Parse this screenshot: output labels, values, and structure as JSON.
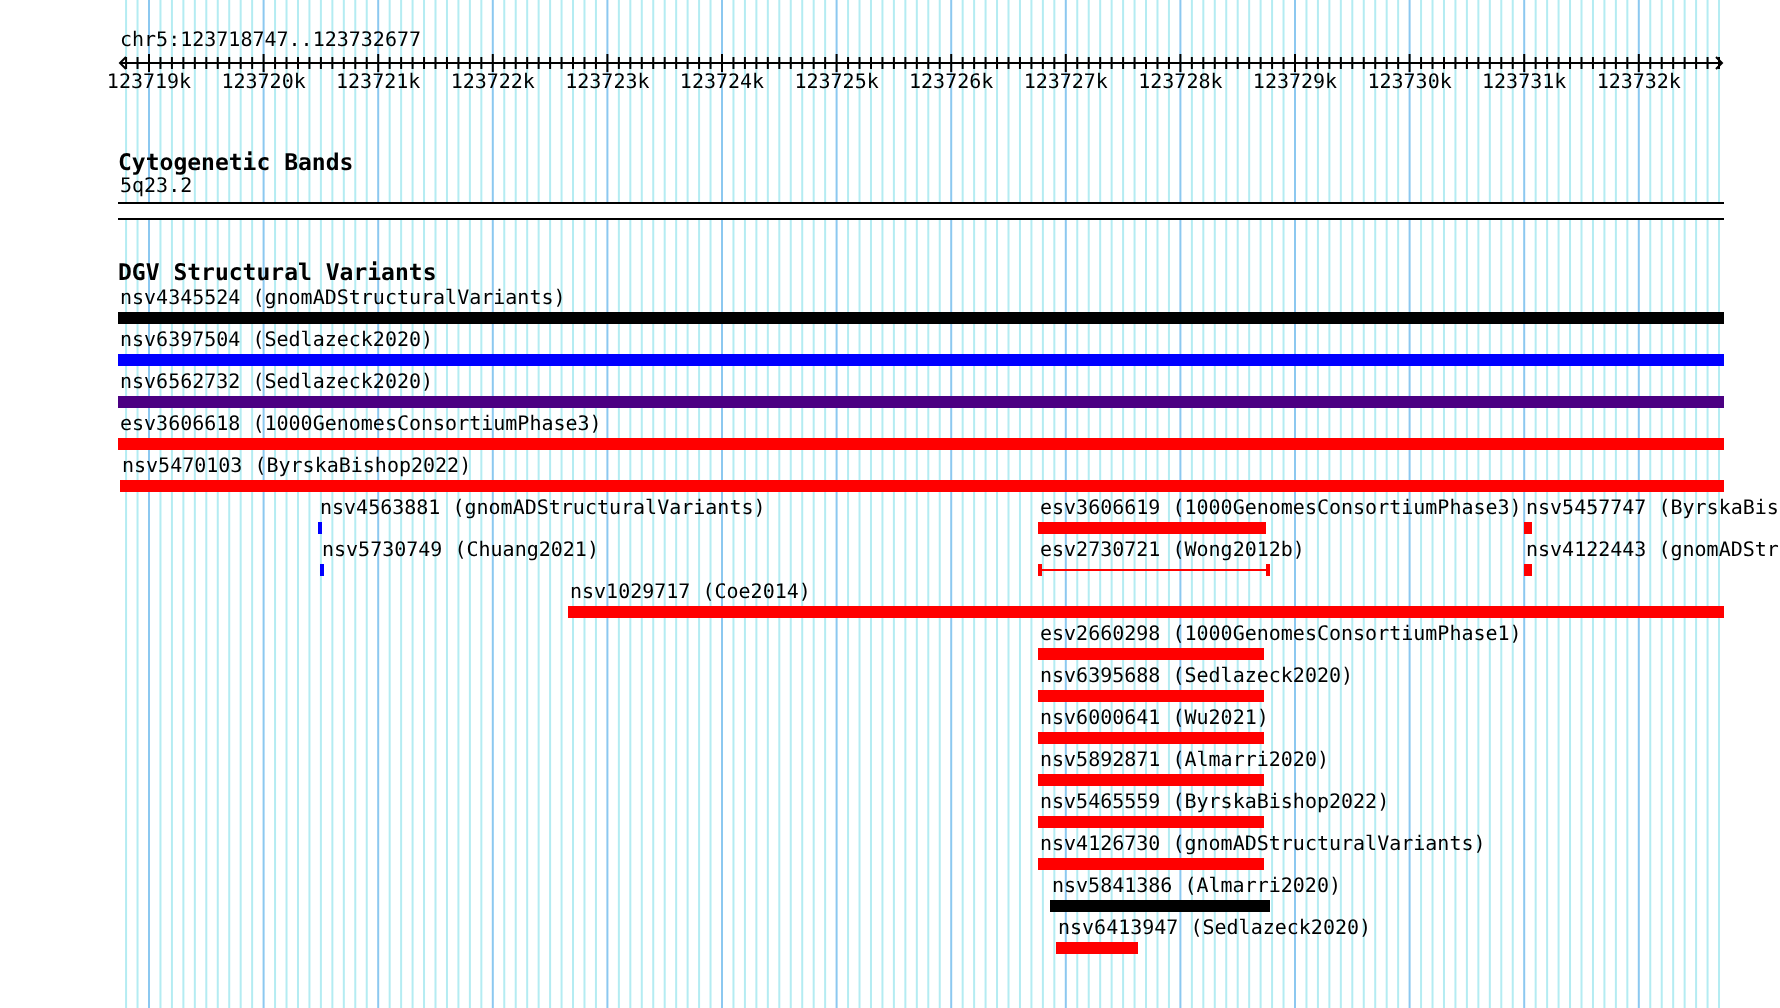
{
  "ruler": {
    "locus": "chr5:123718747..123732677",
    "tick_labels": [
      "123719k",
      "123720k",
      "123721k",
      "123722k",
      "123723k",
      "123724k",
      "123725k",
      "123726k",
      "123727k",
      "123728k",
      "123729k",
      "123730k",
      "123731k",
      "123732k"
    ]
  },
  "cytogenetic_bands": {
    "title": "Cytogenetic Bands",
    "band_label": "5q23.2"
  },
  "dgv_track": {
    "title": "DGV Structural Variants",
    "features": [
      {
        "label": "nsv4345524 (gnomADStructuralVariants)",
        "color": "#000000",
        "kind": "bar"
      },
      {
        "label": "nsv6397504 (Sedlazeck2020)",
        "color": "#0000ff",
        "kind": "bar"
      },
      {
        "label": "nsv6562732 (Sedlazeck2020)",
        "color": "#4b0082",
        "kind": "bar"
      },
      {
        "label": "esv3606618 (1000GenomesConsortiumPhase3)",
        "color": "#ff0000",
        "kind": "bar"
      },
      {
        "label": "nsv5470103 (ByrskaBishop2022)",
        "color": "#ff0000",
        "kind": "bar"
      },
      {
        "label": "nsv4563881 (gnomADStructuralVariants)",
        "color": "#0000ff",
        "kind": "bar"
      },
      {
        "label": "esv3606619 (1000GenomesConsortiumPhase3)",
        "color": "#ff0000",
        "kind": "bar"
      },
      {
        "label": "nsv5457747 (ByrskaBis",
        "color": "#ff0000",
        "kind": "bar"
      },
      {
        "label": "nsv5730749 (Chuang2021)",
        "color": "#0000ff",
        "kind": "bar"
      },
      {
        "label": "esv2730721 (Wong2012b)",
        "color": "#ff0000",
        "kind": "span"
      },
      {
        "label": "nsv4122443 (gnomADStr",
        "color": "#ff0000",
        "kind": "bar"
      },
      {
        "label": "nsv1029717 (Coe2014)",
        "color": "#ff0000",
        "kind": "bar"
      },
      {
        "label": "esv2660298 (1000GenomesConsortiumPhase1)",
        "color": "#ff0000",
        "kind": "bar"
      },
      {
        "label": "nsv6395688 (Sedlazeck2020)",
        "color": "#ff0000",
        "kind": "bar"
      },
      {
        "label": "nsv6000641 (Wu2021)",
        "color": "#ff0000",
        "kind": "bar"
      },
      {
        "label": "nsv5892871 (Almarri2020)",
        "color": "#ff0000",
        "kind": "bar"
      },
      {
        "label": "nsv5465559 (ByrskaBishop2022)",
        "color": "#ff0000",
        "kind": "bar"
      },
      {
        "label": "nsv4126730 (gnomADStructuralVariants)",
        "color": "#ff0000",
        "kind": "bar"
      },
      {
        "label": "nsv5841386 (Almarri2020)",
        "color": "#000000",
        "kind": "bar"
      },
      {
        "label": "nsv6413947 (Sedlazeck2020)",
        "color": "#ff0000",
        "kind": "bar"
      }
    ]
  }
}
